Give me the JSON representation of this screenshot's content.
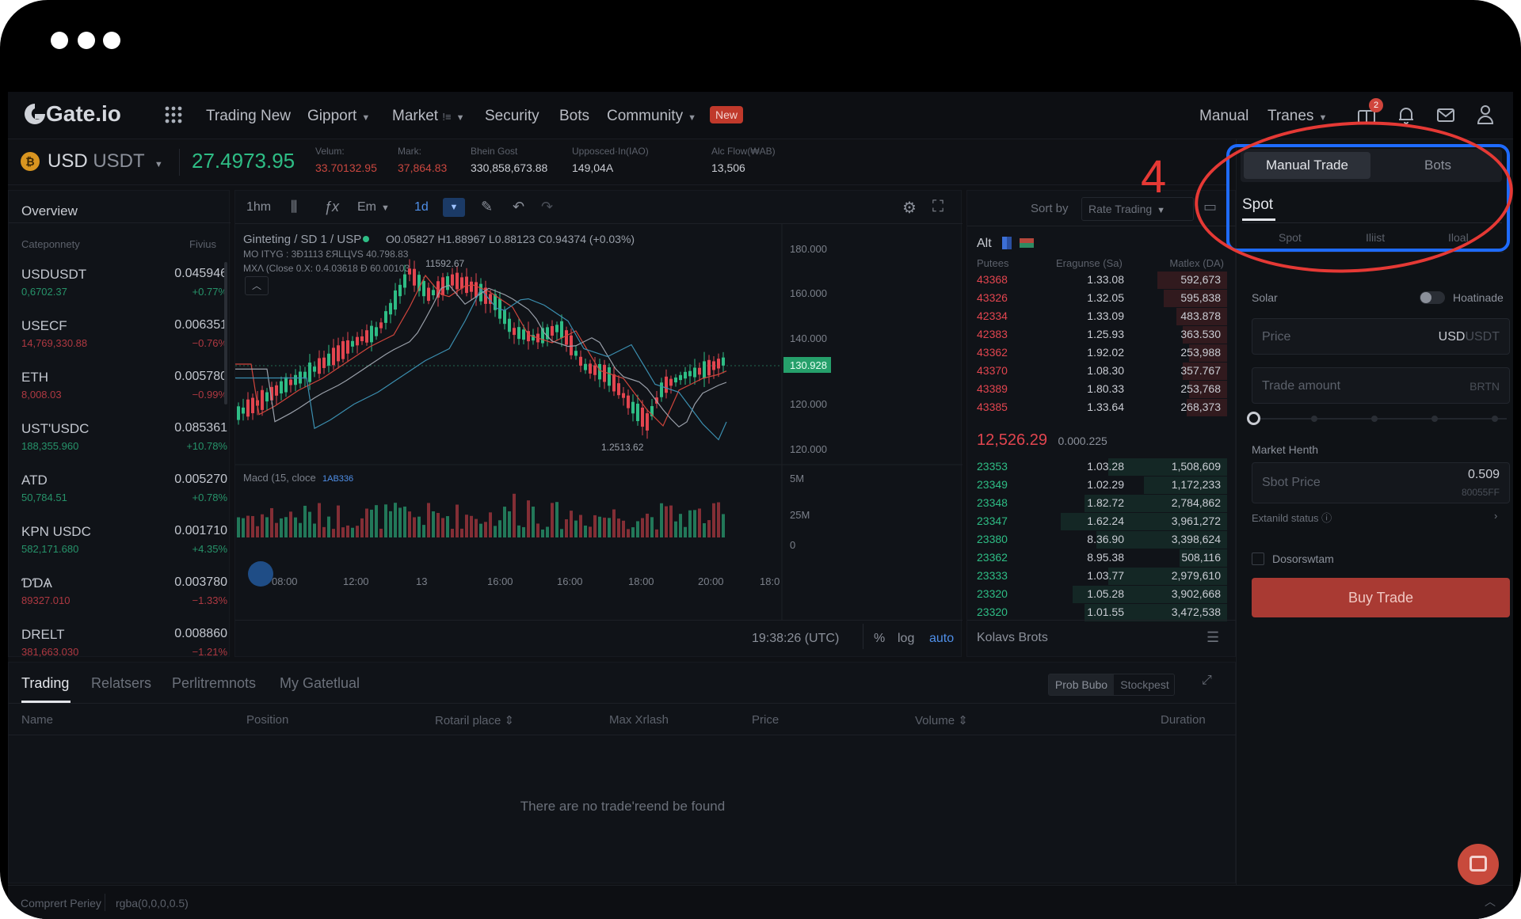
{
  "nav": {
    "logo": "Gate.io",
    "items": [
      "Trading New",
      "Gipport",
      "Market",
      "Security",
      "Bots",
      "Community"
    ],
    "market_suffix": "!≡",
    "new_badge": "New",
    "right": [
      "Manual",
      "Tranes"
    ],
    "notif_count": "2"
  },
  "ticker": {
    "pair": "USD",
    "pair_quote": "USDT",
    "price": "27.4973.95",
    "stats": [
      {
        "label": "Velum:",
        "value": "33.70132.95",
        "color": "red"
      },
      {
        "label": "Mark:",
        "value": "37,864.83",
        "color": "red"
      },
      {
        "label": "Bhein Gost",
        "value": "330,858,673.88",
        "color": "white"
      },
      {
        "label": "Upposced·In(IAO)",
        "value": "149,04A",
        "color": "white"
      },
      {
        "label": "Alc Flow(₩AB)",
        "value": "13,506",
        "color": "white"
      }
    ]
  },
  "annotation": {
    "step": "4",
    "color": "#e53935",
    "highlight": "#1e6bff"
  },
  "market_list": {
    "title": "Overview",
    "header_left": "Cateponnety",
    "header_right": "Fivius",
    "rows": [
      {
        "name": "USDUSDT",
        "value": "0.045946",
        "sub": "0,6702.37",
        "change": "+0.77%",
        "up": true
      },
      {
        "name": "USECF",
        "value": "0.006351",
        "sub": "14,769,330.88",
        "change": "−0.76%",
        "up": false
      },
      {
        "name": "ETH",
        "value": "0.005780",
        "sub": "8,008.03",
        "change": "−0.99%",
        "up": false
      },
      {
        "name": "UST'USDC",
        "value": "0.085361",
        "sub": "188,355.960",
        "change": "+10.78%",
        "up": true
      },
      {
        "name": "ATD",
        "value": "0.005270",
        "sub": "50,784.51",
        "change": "+0.78%",
        "up": true
      },
      {
        "name": "KPN USDC",
        "value": "0.001710",
        "sub": "582,171.680",
        "change": "+4.35%",
        "up": true
      },
      {
        "name": "ƊƊѦ",
        "value": "0.003780",
        "sub": "89327.010",
        "change": "−1.33%",
        "up": false
      },
      {
        "name": "DRELT",
        "value": "0.008860",
        "sub": "381,663.030",
        "change": "−1.21%",
        "up": false
      }
    ]
  },
  "chart": {
    "toolbar": {
      "interval": "1hm",
      "indicator": "Em",
      "range": "1d"
    },
    "legend_title": "Ginteting / SD 1 / USP",
    "ohlc": "O0.05827  H1.88967  L0.88123  C0.94374  (+0.03%)",
    "line2": "MO ITYG : 3Ð1113  ƐЯLЦVS  40.798.83",
    "line3": "MXΛ (Close 0.X: 0.4.03618  Đ  60.00103",
    "peak_label": "11592.67",
    "trough_label": "1.2513.62",
    "price_axis": [
      "180.000",
      "160.000",
      "140.000",
      "130.928",
      "120.000",
      "120.000"
    ],
    "volume_axis": [
      "5M",
      "25M",
      "0"
    ],
    "macd_label": "Macd (15, cloce",
    "macd_value": "1AB336",
    "time_axis": [
      "08:00",
      "12:00",
      "13",
      "16:00",
      "16:00",
      "18:00",
      "20:00",
      "18:0"
    ],
    "timestamp": "19:38:26 (UTC)",
    "footer_opts": [
      "%",
      "log",
      "auto"
    ]
  },
  "orderbook": {
    "sort_label": "Sort by",
    "sort_value": "Rate Trading",
    "tab": "Alt",
    "headers": [
      "Putees",
      "Eragunse (Sa)",
      "Matlex (DA)"
    ],
    "asks": [
      [
        "43368",
        "1.33.08",
        "592,673"
      ],
      [
        "43326",
        "1.32.05",
        "595,838"
      ],
      [
        "42334",
        "1.33.09",
        "483.878"
      ],
      [
        "42383",
        "1.25.93",
        "363.530"
      ],
      [
        "43362",
        "1.92.02",
        "253,988"
      ],
      [
        "43370",
        "1.08.30",
        "357.767"
      ],
      [
        "43389",
        "1.80.33",
        "253,768"
      ],
      [
        "43385",
        "1.33.64",
        "268,373"
      ]
    ],
    "mid_price": "12,526.29",
    "mid_sub": "0.000.225",
    "bids": [
      [
        "23353",
        "1.03.28",
        "1,508,609"
      ],
      [
        "23349",
        "1.02.29",
        "1,172,233"
      ],
      [
        "23348",
        "1.82.72",
        "2,784,862"
      ],
      [
        "23347",
        "1.62.24",
        "3,961,272"
      ],
      [
        "23380",
        "8.36.90",
        "3,398,624"
      ],
      [
        "23362",
        "8.95.38",
        "508,116"
      ],
      [
        "23333",
        "1.03.77",
        "2,979,610"
      ],
      [
        "23320",
        "1.05.28",
        "3,902,668"
      ],
      [
        "23320",
        "1.01.55",
        "3,472,538"
      ]
    ],
    "footer": "Kolavs Brots"
  },
  "trade": {
    "tabs": [
      "Manual Trade",
      "Bots"
    ],
    "sub_tab": "Spot",
    "order_tabs": [
      "Spot",
      "Iliist",
      "Iloal"
    ],
    "solar_label": "Solar",
    "toggle_label": "Hoatinade",
    "price_placeholder": "Price",
    "price_unit": "USD",
    "price_unit2": "USDT",
    "amount_placeholder": "Trade amount",
    "amount_unit": "BRTN",
    "market_label": "Market Henth",
    "spot_price_label": "Sbot Price",
    "spot_price_value": "0.509",
    "spot_price_sub": "80055FF",
    "extend_label": "Extanild status",
    "checkbox_label": "Dosorswtam",
    "buy_button": "Buy Trade"
  },
  "bottom": {
    "tabs": [
      "Trading",
      "Relatsers",
      "Perlitremnots",
      "My Gatetlual"
    ],
    "seg": [
      "Prob Bubo",
      "Stockpest"
    ],
    "columns": [
      "Name",
      "Position",
      "Rotaril place",
      "Max Xrlash",
      "Price",
      "Volume",
      "Duration"
    ],
    "empty": "There are no trade'reend be found"
  },
  "status_bar": [
    "Comprert Periey",
    "rgba(0,0,0,0.5)"
  ]
}
